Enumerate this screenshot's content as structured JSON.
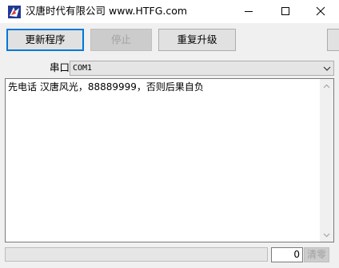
{
  "window": {
    "title": "汉唐时代有限公司 www.HTFG.com",
    "controls": [
      "minimize-icon",
      "maximize-icon",
      "close-icon"
    ]
  },
  "toolbar": {
    "update_label": "更新程序",
    "stop_label": "停止",
    "upgrade_label": "重复升级"
  },
  "port": {
    "label": "串口",
    "selected": "COM1"
  },
  "log": {
    "text": "先电话 汉唐风光，88889999，否则后果自负"
  },
  "status": {
    "progress": 0,
    "count": "0",
    "clear_label": "清零"
  },
  "colors": {
    "accent": "#0078d7",
    "progress_fill": "#06b025"
  }
}
